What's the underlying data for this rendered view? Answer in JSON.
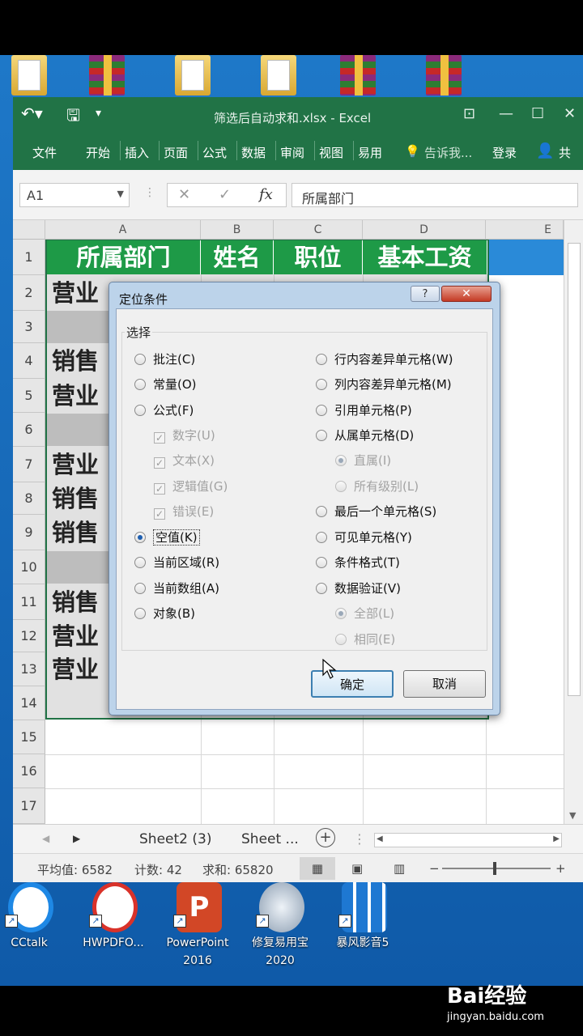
{
  "excel": {
    "title": "筛选后自动求和.xlsx - Excel",
    "ribbon_tabs": [
      "文件",
      "开始",
      "插入",
      "页面",
      "公式",
      "数据",
      "审阅",
      "视图",
      "易用"
    ],
    "tell_me": "告诉我...",
    "login": "登录",
    "share": "共",
    "name_box": "A1",
    "formula_value": "所属部门",
    "column_headers": [
      "A",
      "B",
      "C",
      "D",
      "E"
    ],
    "row_numbers": [
      "1",
      "2",
      "3",
      "4",
      "5",
      "6",
      "7",
      "8",
      "9",
      "10",
      "11",
      "12",
      "13",
      "14",
      "15",
      "16",
      "17"
    ],
    "header_row": [
      "所属部门",
      "姓名",
      "职位",
      "基本工资"
    ],
    "col_a_values": [
      "营业",
      "",
      "销售",
      "营业",
      "",
      "营业",
      "销售",
      "销售",
      "",
      "销售",
      "营业",
      "营业"
    ],
    "sheet_tabs": [
      "Sheet2 (3)",
      "Sheet ..."
    ],
    "status": {
      "average": "平均值: 6582",
      "count": "计数: 42",
      "sum": "求和: 65820"
    }
  },
  "dialog": {
    "title": "定位条件",
    "help": "?",
    "group_label": "选择",
    "left_options": [
      {
        "label": "批注(C)",
        "kind": "radio",
        "selected": false,
        "disabled": false
      },
      {
        "label": "常量(O)",
        "kind": "radio",
        "selected": false,
        "disabled": false
      },
      {
        "label": "公式(F)",
        "kind": "radio",
        "selected": false,
        "disabled": false
      },
      {
        "label": "数字(U)",
        "kind": "check",
        "selected": true,
        "disabled": true
      },
      {
        "label": "文本(X)",
        "kind": "check",
        "selected": true,
        "disabled": true
      },
      {
        "label": "逻辑值(G)",
        "kind": "check",
        "selected": true,
        "disabled": true
      },
      {
        "label": "错误(E)",
        "kind": "check",
        "selected": true,
        "disabled": true
      },
      {
        "label": "空值(K)",
        "kind": "radio",
        "selected": true,
        "disabled": false
      },
      {
        "label": "当前区域(R)",
        "kind": "radio",
        "selected": false,
        "disabled": false
      },
      {
        "label": "当前数组(A)",
        "kind": "radio",
        "selected": false,
        "disabled": false
      },
      {
        "label": "对象(B)",
        "kind": "radio",
        "selected": false,
        "disabled": false
      }
    ],
    "right_options": [
      {
        "label": "行内容差异单元格(W)",
        "kind": "radio",
        "selected": false,
        "disabled": false
      },
      {
        "label": "列内容差异单元格(M)",
        "kind": "radio",
        "selected": false,
        "disabled": false
      },
      {
        "label": "引用单元格(P)",
        "kind": "radio",
        "selected": false,
        "disabled": false
      },
      {
        "label": "从属单元格(D)",
        "kind": "radio",
        "selected": false,
        "disabled": false
      },
      {
        "label": "直属(I)",
        "kind": "radio",
        "selected": true,
        "disabled": true
      },
      {
        "label": "所有级别(L)",
        "kind": "radio",
        "selected": false,
        "disabled": true
      },
      {
        "label": "最后一个单元格(S)",
        "kind": "radio",
        "selected": false,
        "disabled": false
      },
      {
        "label": "可见单元格(Y)",
        "kind": "radio",
        "selected": false,
        "disabled": false
      },
      {
        "label": "条件格式(T)",
        "kind": "radio",
        "selected": false,
        "disabled": false
      },
      {
        "label": "数据验证(V)",
        "kind": "radio",
        "selected": false,
        "disabled": false
      },
      {
        "label": "全部(L)",
        "kind": "radio",
        "selected": true,
        "disabled": true
      },
      {
        "label": "相同(E)",
        "kind": "radio",
        "selected": false,
        "disabled": true
      }
    ],
    "ok": "确定",
    "cancel": "取消"
  },
  "taskbar_icons": [
    {
      "name": "CCtalk",
      "label": "CCtalk",
      "color": "#1e88e5"
    },
    {
      "name": "hwpdfo",
      "label": "HWPDFO...",
      "color": "#d9322a"
    },
    {
      "name": "powerpoint",
      "label": "PowerPoint 2016",
      "color": "#d24726"
    },
    {
      "name": "repair-tool",
      "label": "修复易用宝 2020",
      "color": "#5a6f86"
    },
    {
      "name": "storm-player",
      "label": "暴风影音5",
      "color": "#1e78d2"
    }
  ],
  "watermark": {
    "brand": "Bai经验",
    "url": "jingyan.baidu.com"
  }
}
